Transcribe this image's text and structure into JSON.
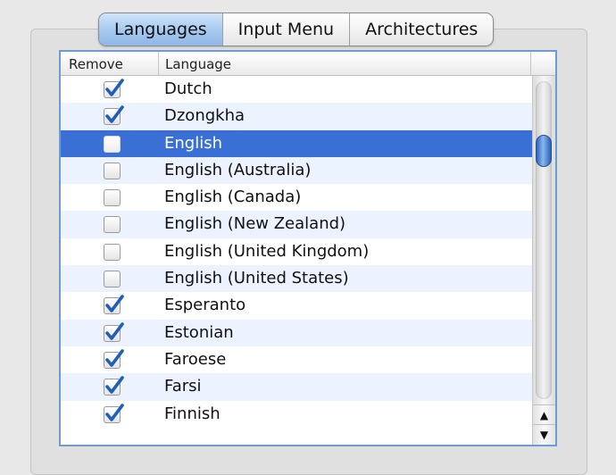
{
  "tabs": [
    {
      "label": "Languages",
      "active": true
    },
    {
      "label": "Input Menu",
      "active": false
    },
    {
      "label": "Architectures",
      "active": false
    }
  ],
  "table": {
    "columns": {
      "remove": "Remove",
      "language": "Language"
    },
    "rows": [
      {
        "language": "Dutch",
        "remove": true
      },
      {
        "language": "Dzongkha",
        "remove": true
      },
      {
        "language": "English",
        "remove": false,
        "selected": true
      },
      {
        "language": "English (Australia)",
        "remove": false
      },
      {
        "language": "English (Canada)",
        "remove": false
      },
      {
        "language": "English (New Zealand)",
        "remove": false
      },
      {
        "language": "English (United Kingdom)",
        "remove": false
      },
      {
        "language": "English (United States)",
        "remove": false
      },
      {
        "language": "Esperanto",
        "remove": true
      },
      {
        "language": "Estonian",
        "remove": true
      },
      {
        "language": "Faroese",
        "remove": true
      },
      {
        "language": "Farsi",
        "remove": true
      },
      {
        "language": "Finnish",
        "remove": true
      }
    ]
  },
  "scrollbar": {
    "up_icon": "▲",
    "down_icon": "▼"
  },
  "colors": {
    "selection": "#3a6fd6",
    "checkmark": "#1f5fb8",
    "table_border": "#6d9bd4"
  }
}
